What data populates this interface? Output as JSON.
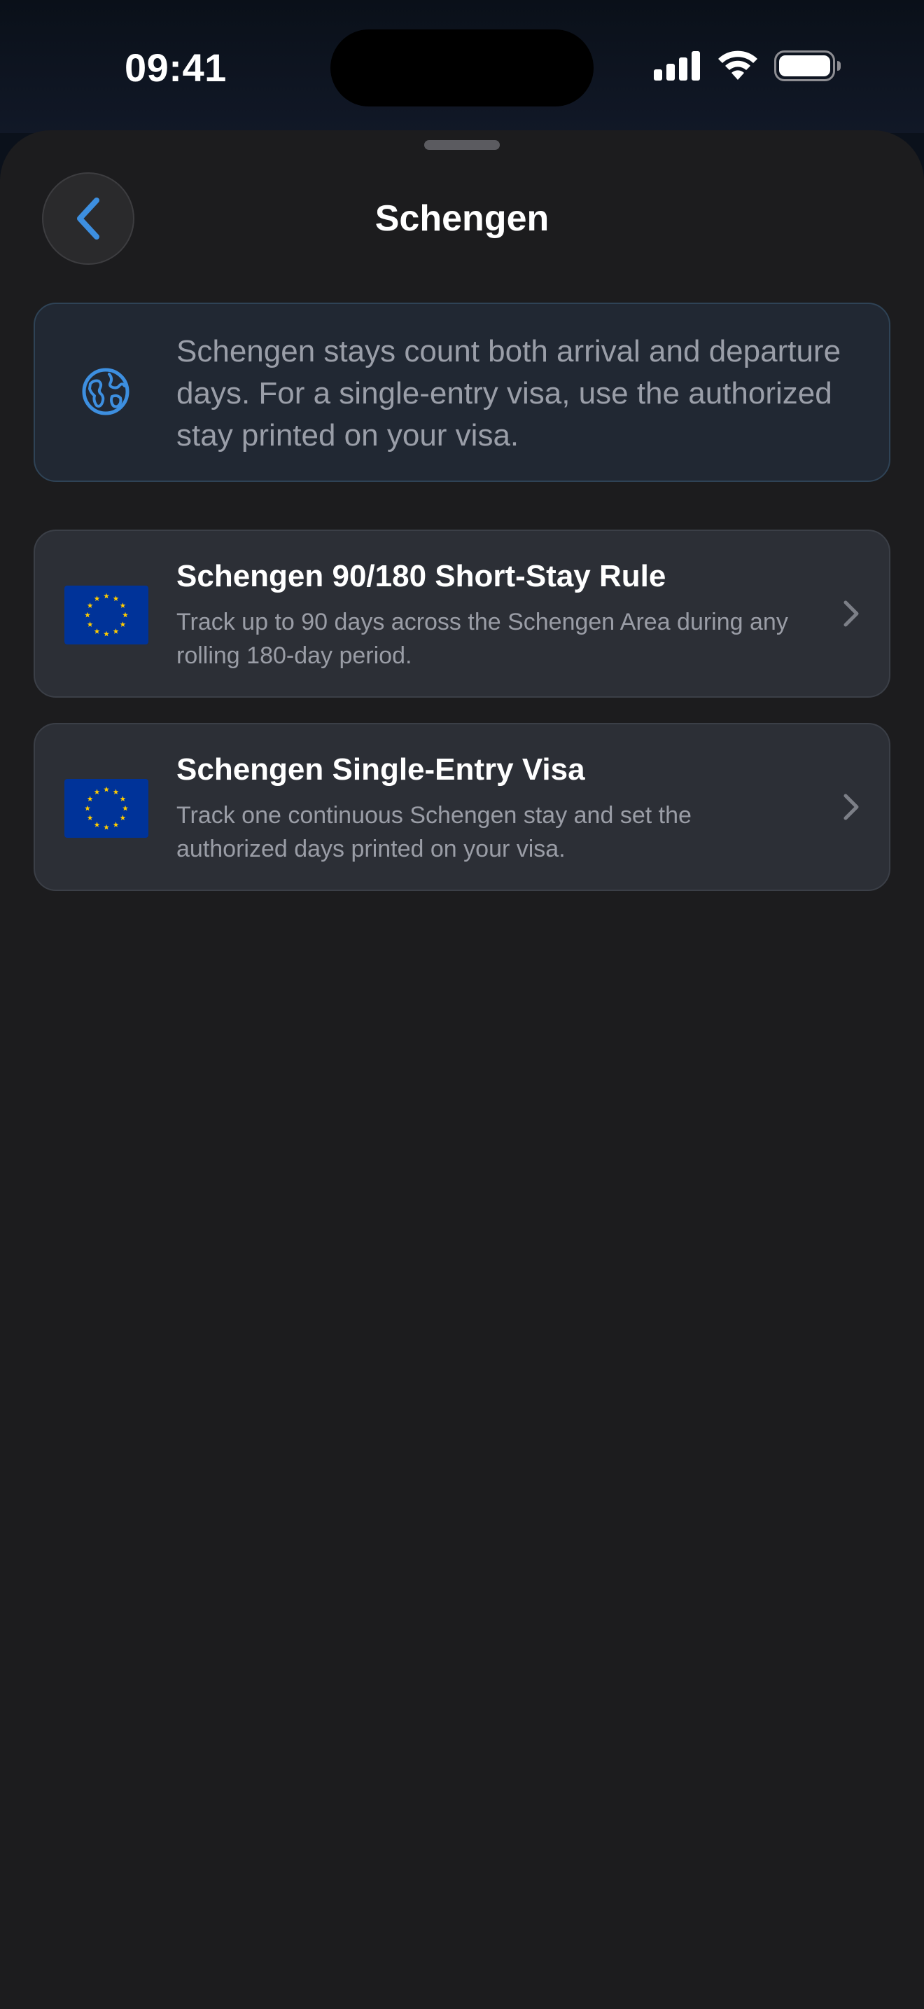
{
  "status_bar": {
    "time": "09:41"
  },
  "header": {
    "title": "Schengen",
    "back_icon": "chevron-left-icon"
  },
  "info": {
    "icon": "globe-icon",
    "text": "Schengen stays count both arrival and departure days. For a single-entry visa, use the authorized stay printed on your visa."
  },
  "options": [
    {
      "icon": "eu-flag-icon",
      "title": "Schengen 90/180 Short-Stay Rule",
      "description": "Track up to 90 days across the Schengen Area during any rolling 180-day period."
    },
    {
      "icon": "eu-flag-icon",
      "title": "Schengen Single-Entry Visa",
      "description": "Track one continuous Schengen stay and set the authorized days printed on your visa."
    }
  ],
  "colors": {
    "accent": "#3d8fe0",
    "sheet_background": "#1c1c1e",
    "card_background": "#2c2f36",
    "info_background": "#212833",
    "eu_blue": "#003399",
    "eu_gold": "#ffcc00"
  }
}
